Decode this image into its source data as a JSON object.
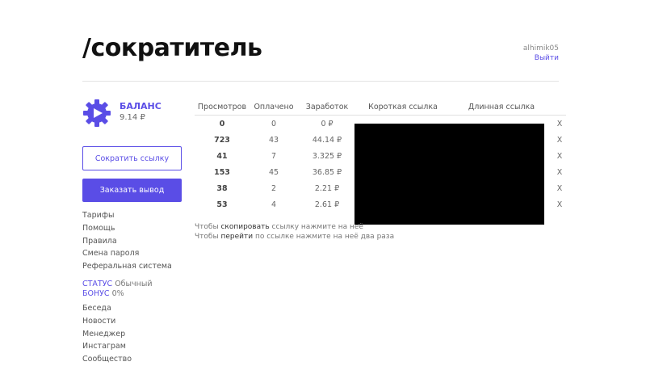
{
  "header": {
    "logo": "/сократитель",
    "username": "alhimik05",
    "logout": "Выйти"
  },
  "balance": {
    "title": "БАЛАНС",
    "value": "9.14 ₽"
  },
  "buttons": {
    "shorten": "Сократить ссылку",
    "withdraw": "Заказать вывод"
  },
  "menu": [
    "Тарифы",
    "Помощь",
    "Правила",
    "Смена пароля",
    "Реферальная система"
  ],
  "status": {
    "status_label": "СТАТУС",
    "status_value": "Обычный",
    "bonus_label": "БОНУС",
    "bonus_value": "0%"
  },
  "menu2": [
    "Беседа",
    "Новости",
    "Менеджер",
    "Инстаграм",
    "Сообщество"
  ],
  "table": {
    "headers": [
      "Просмотров",
      "Оплачено",
      "Заработок",
      "Короткая ссылка",
      "Длинная ссылка"
    ],
    "rows": [
      {
        "views": "0",
        "paid": "0",
        "earned": "0 ₽",
        "short": "",
        "long": "",
        "delete": "X"
      },
      {
        "views": "723",
        "paid": "43",
        "earned": "44.14 ₽",
        "short": "",
        "long": "",
        "delete": "X"
      },
      {
        "views": "41",
        "paid": "7",
        "earned": "3.325 ₽",
        "short": "",
        "long": "",
        "delete": "X"
      },
      {
        "views": "153",
        "paid": "45",
        "earned": "36.85 ₽",
        "short": "",
        "long": "",
        "delete": "X"
      },
      {
        "views": "38",
        "paid": "2",
        "earned": "2.21 ₽",
        "short": "",
        "long": "",
        "delete": "X"
      },
      {
        "views": "53",
        "paid": "4",
        "earned": "2.61 ₽",
        "short": "",
        "long": "",
        "delete": "X"
      }
    ]
  },
  "hints": {
    "line1_pre": "Чтобы",
    "line1_action": "скопировать",
    "line1_post": "ссылку нажмите на неё",
    "line2_pre": "Чтобы",
    "line2_action": "перейти",
    "line2_post": "по ссылке нажмите на неё два раза"
  },
  "colors": {
    "accent": "#5a4de6",
    "redaction": "#000000"
  }
}
